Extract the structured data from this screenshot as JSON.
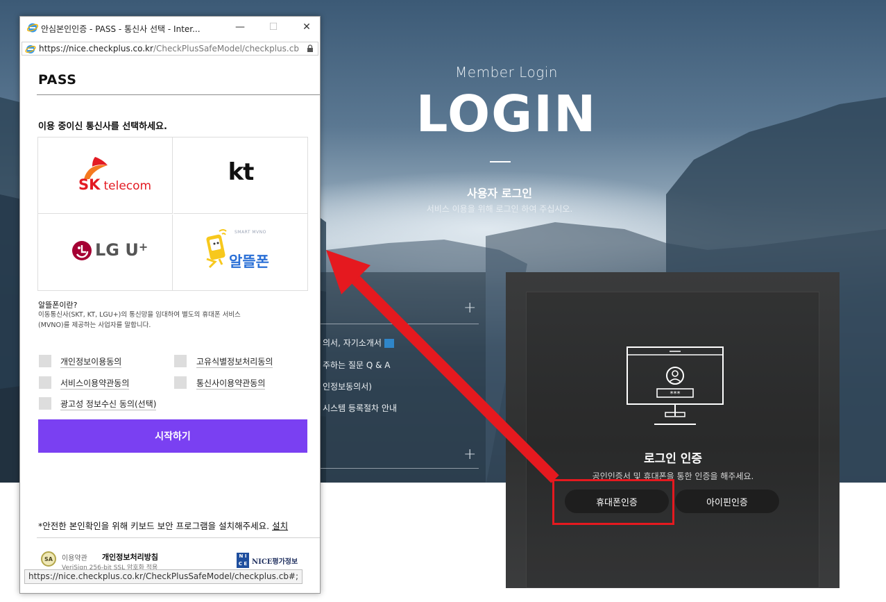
{
  "background_page": {
    "hero": {
      "subtitle": "Member Login",
      "title": "LOGIN",
      "user_login": "사용자 로그인",
      "description": "서비스 이용을 위해 로그인 하여 주십시오."
    },
    "left_panel": {
      "items": [
        "의서, 자기소개서",
        "주하는 질문 Q & A",
        "인정보동의서)",
        "시스템 등록절차 안내"
      ]
    },
    "auth_panel": {
      "title": "로그인 인증",
      "description": "공인인증서 및 휴대폰을 통한 인증을 해주세요.",
      "pin_mask": "***",
      "buttons": {
        "phone": "휴대폰인증",
        "ipin": "아이핀인증"
      }
    }
  },
  "popup": {
    "window_title": "안심본인인증 - PASS - 통신사 선택 - Inter...",
    "window_controls": {
      "minimize": "—",
      "maximize": "☐",
      "close": "✕"
    },
    "url_host": "https://nice.checkplus.co.kr",
    "url_path": "/CheckPlusSafeModel/checkplus.cb",
    "brand": "PASS",
    "instruction": "이용 중이신 통신사를 선택하세요.",
    "carriers": [
      {
        "id": "skt",
        "name": "SK telecom",
        "prefix": "SK",
        "suffix": "telecom"
      },
      {
        "id": "kt",
        "name": "kt"
      },
      {
        "id": "lgu",
        "name": "LG U+",
        "prefix": "LG U",
        "suffix": "+"
      },
      {
        "id": "mvno",
        "name": "알뜰폰",
        "tagline": "SMART MVNO"
      }
    ],
    "mvno_question": "알뜰폰이란?",
    "mvno_description": "이동통신사(SKT, KT, LGU+)의 통신망을 임대하여 별도의 휴대폰 서비스(MVNO)를 제공하는 사업자를 말합니다.",
    "agreements": [
      {
        "label": "개인정보이용동의"
      },
      {
        "label": "고유식별정보처리동의"
      },
      {
        "label": "서비스이용약관동의"
      },
      {
        "label": "통신사이용약관동의"
      },
      {
        "label": "광고성 정보수신 동의(선택)"
      }
    ],
    "start_button": "시작하기",
    "keyboard_notice": "*안전한 본인확인을 위해 키보드 보안 프로그램을 설치해주세요.",
    "install_link": "설치",
    "footer": {
      "seal": "SA",
      "terms": "이용약관",
      "privacy": "개인정보처리방침",
      "ssl": "VeriSign 256-bit SSL 암호화 적용",
      "nice_mark": "N I C E",
      "nice": "NICE평가정보"
    },
    "status_url": "https://nice.checkplus.co.kr/CheckPlusSafeModel/checkplus.cb#;"
  },
  "colors": {
    "start_button": "#7a40f2",
    "highlight_red": "#e5191f",
    "sk_orange": "#f47920",
    "sk_red": "#e31b23",
    "lg_red": "#a50034",
    "kt_black": "#111111",
    "mvno_blue": "#2a6fd6",
    "mvno_yellow": "#f7c81d"
  }
}
